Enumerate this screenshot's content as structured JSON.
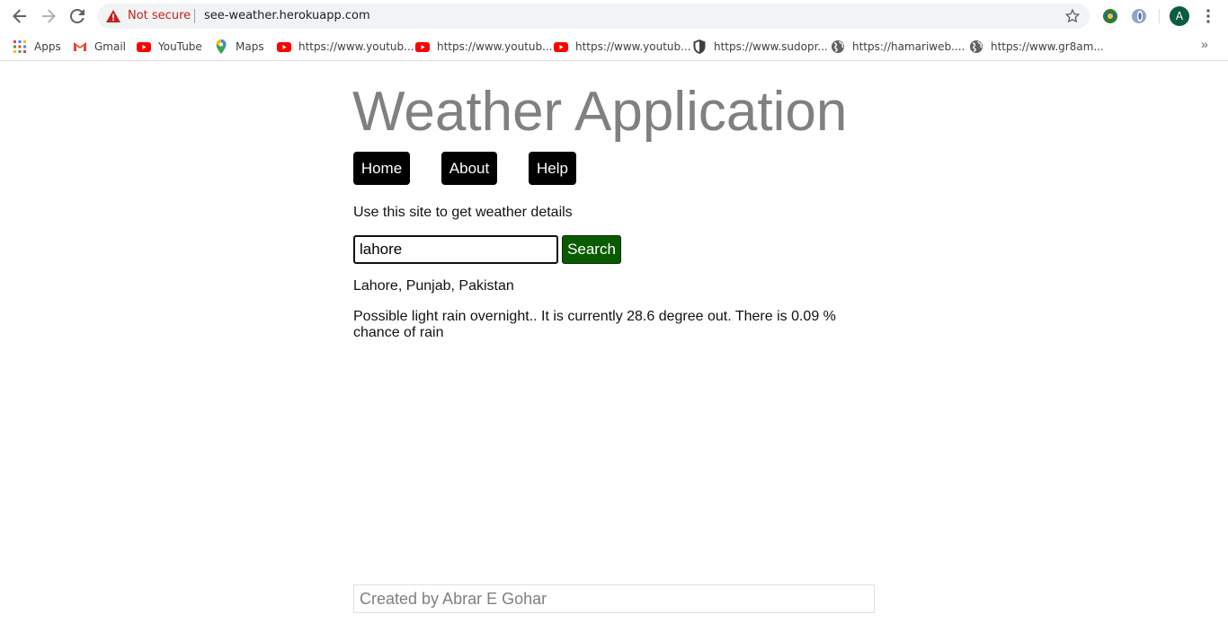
{
  "browser": {
    "security_label": "Not secure",
    "url": "see-weather.herokuapp.com",
    "profile_initial": "A",
    "bookmarks": [
      {
        "label": "Apps",
        "icon": "apps-grid-icon"
      },
      {
        "label": "Gmail",
        "icon": "gmail-icon"
      },
      {
        "label": "YouTube",
        "icon": "youtube-icon"
      },
      {
        "label": "Maps",
        "icon": "maps-pin-icon"
      },
      {
        "label": "https://www.youtub...",
        "icon": "youtube-icon"
      },
      {
        "label": "https://www.youtub...",
        "icon": "youtube-icon"
      },
      {
        "label": "https://www.youtub...",
        "icon": "youtube-icon"
      },
      {
        "label": "https://www.sudopr...",
        "icon": "shield-icon"
      },
      {
        "label": "https://hamariweb....",
        "icon": "globe-icon"
      },
      {
        "label": "https://www.gr8am...",
        "icon": "globe-icon"
      }
    ],
    "more_bookmarks": "»"
  },
  "page": {
    "title": "Weather Application",
    "nav": [
      {
        "label": "Home"
      },
      {
        "label": "About"
      },
      {
        "label": "Help"
      }
    ],
    "tagline": "Use this site to get weather details",
    "search": {
      "value": "lahore",
      "button_label": "Search"
    },
    "location": "Lahore, Punjab, Pakistan",
    "forecast": "Possible light rain overnight.. It is currently 28.6 degree out. There is 0.09 % chance of rain",
    "footer": "Created by Abrar E Gohar"
  },
  "colors": {
    "title": "#808080",
    "nav_bg": "#000000",
    "search_button": "#0a5a00",
    "warning": "#c5221f"
  }
}
